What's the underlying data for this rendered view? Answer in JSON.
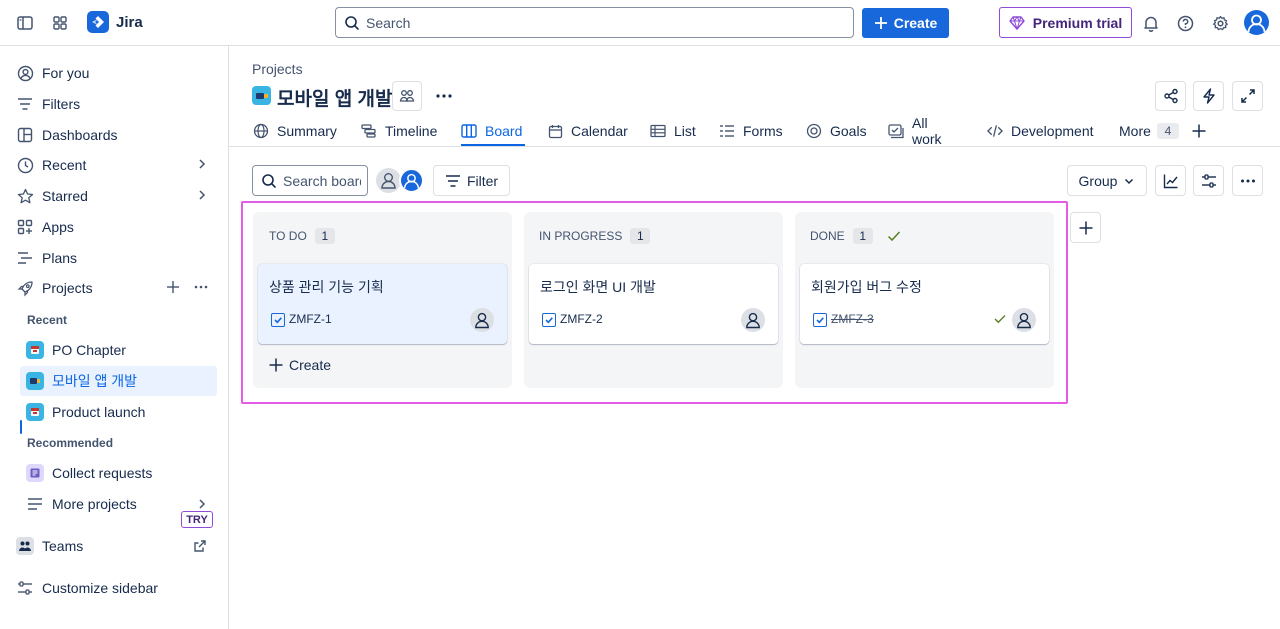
{
  "app": {
    "name": "Jira"
  },
  "topbar": {
    "search_placeholder": "Search",
    "create_label": "Create",
    "premium_label": "Premium trial"
  },
  "sidebar": {
    "items": [
      {
        "label": "For you",
        "icon": "user-circle-icon"
      },
      {
        "label": "Filters",
        "icon": "filter-icon"
      },
      {
        "label": "Dashboards",
        "icon": "dashboard-icon"
      },
      {
        "label": "Recent",
        "icon": "clock-icon"
      },
      {
        "label": "Starred",
        "icon": "star-icon"
      },
      {
        "label": "Apps",
        "icon": "apps-icon"
      },
      {
        "label": "Plans",
        "icon": "plans-icon"
      },
      {
        "label": "Projects",
        "icon": "rocket-icon"
      }
    ],
    "recent_heading": "Recent",
    "recent_projects": [
      "PO Chapter",
      "모바일 앱 개발",
      "Product launch"
    ],
    "recommended_heading": "Recommended",
    "recommended": [
      {
        "label": "Collect requests",
        "badge": "TRY"
      },
      {
        "label": "More projects"
      }
    ],
    "teams_label": "Teams",
    "customize_label": "Customize sidebar"
  },
  "project": {
    "breadcrumb": "Projects",
    "title": "모바일 앱 개발"
  },
  "tabs": [
    {
      "label": "Summary",
      "icon": "globe-icon"
    },
    {
      "label": "Timeline",
      "icon": "timeline-icon"
    },
    {
      "label": "Board",
      "icon": "board-icon",
      "active": true
    },
    {
      "label": "Calendar",
      "icon": "calendar-icon"
    },
    {
      "label": "List",
      "icon": "list-icon"
    },
    {
      "label": "Forms",
      "icon": "forms-icon"
    },
    {
      "label": "Goals",
      "icon": "goal-icon"
    },
    {
      "label": "All work",
      "icon": "all-work-icon"
    },
    {
      "label": "Development",
      "icon": "code-icon"
    }
  ],
  "tabs_more": {
    "label": "More",
    "count": "4"
  },
  "toolbar": {
    "search_placeholder": "Search board",
    "filter_label": "Filter",
    "group_label": "Group"
  },
  "board": {
    "columns": [
      {
        "name": "TO DO",
        "count": "1",
        "cards": [
          {
            "title": "상품 관리 기능 기획",
            "key": "ZMFZ-1"
          }
        ],
        "create_label": "Create"
      },
      {
        "name": "IN PROGRESS",
        "count": "1",
        "cards": [
          {
            "title": "로그인 화면 UI 개발",
            "key": "ZMFZ-2"
          }
        ]
      },
      {
        "name": "DONE",
        "count": "1",
        "cards": [
          {
            "title": "회원가입 버그 수정",
            "key": "ZMFZ-3"
          }
        ]
      }
    ]
  },
  "colors": {
    "accent": "#1868db",
    "premium": "#8f4bd6",
    "highlight": "#e35ce6",
    "done_check": "#5b7f24"
  }
}
